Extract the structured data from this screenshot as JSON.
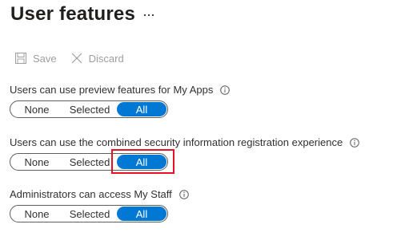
{
  "header": {
    "title": "User features",
    "more_icon": "ellipsis-icon"
  },
  "toolbar": {
    "save_label": "Save",
    "save_icon": "save-icon",
    "discard_label": "Discard",
    "discard_icon": "close-icon"
  },
  "settings": [
    {
      "label": "Users can use preview features for My Apps",
      "options": [
        "None",
        "Selected",
        "All"
      ],
      "selected": "All"
    },
    {
      "label": "Users can use the combined security information registration experience",
      "options": [
        "None",
        "Selected",
        "All"
      ],
      "selected": "All"
    },
    {
      "label": "Administrators can access My Staff",
      "options": [
        "None",
        "Selected",
        "All"
      ],
      "selected": "All"
    }
  ],
  "colors": {
    "accent": "#0078d4",
    "highlight": "#e81123",
    "disabled_text": "#a19f9d"
  }
}
